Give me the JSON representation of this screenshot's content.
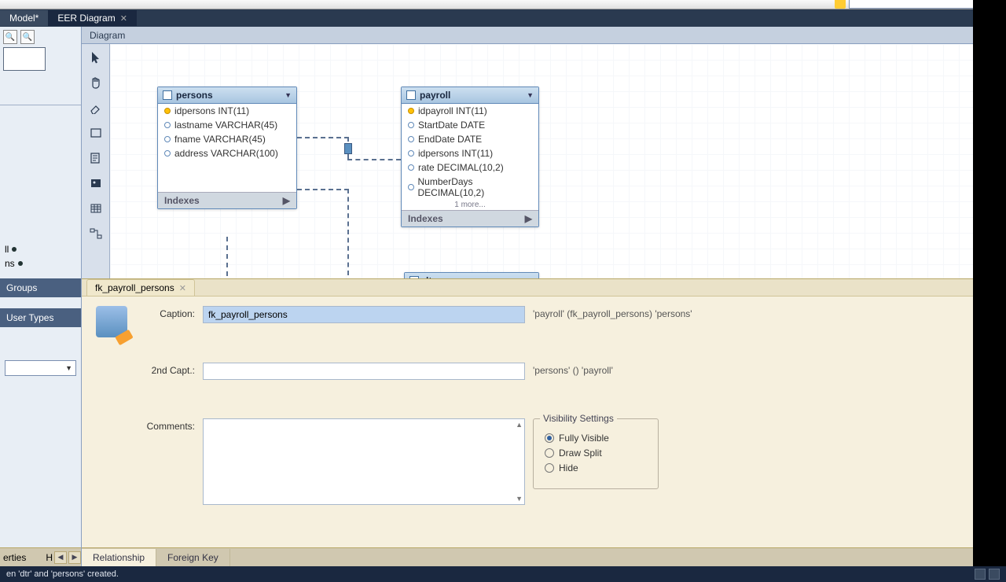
{
  "topbar": {
    "search_placeholder": ""
  },
  "tabs": {
    "model": "Model*",
    "eer": "EER Diagram"
  },
  "diagram_label": "Diagram",
  "left_tree": {
    "item1": "ll",
    "item2": "ns"
  },
  "left_sections": {
    "groups": "Groups",
    "user_types": "User Types"
  },
  "entities": {
    "persons": {
      "name": "persons",
      "cols": [
        "idpersons INT(11)",
        "lastname VARCHAR(45)",
        "fname VARCHAR(45)",
        "address VARCHAR(100)"
      ],
      "indexes": "Indexes"
    },
    "payroll": {
      "name": "payroll",
      "cols": [
        "idpayroll INT(11)",
        "StartDate DATE",
        "EndDate DATE",
        "idpersons INT(11)",
        "rate DECIMAL(10,2)",
        "NumberDays DECIMAL(10,2)"
      ],
      "more": "1 more...",
      "indexes": "Indexes"
    },
    "dtr_partial": "dtr"
  },
  "props_tab": "fk_payroll_persons",
  "props": {
    "labels": {
      "caption": "Caption:",
      "caption2": "2nd Capt.:",
      "comments": "Comments:"
    },
    "caption_value": "fk_payroll_persons",
    "caption2_value": "",
    "info1": "'payroll' (fk_payroll_persons) 'persons'",
    "info2": "'persons' () 'payroll'",
    "visibility": {
      "legend": "Visibility Settings",
      "fully": "Fully Visible",
      "draw_split": "Draw Split",
      "hide": "Hide"
    }
  },
  "bottom_tabs": {
    "relationship": "Relationship",
    "foreign_key": "Foreign Key"
  },
  "side_tabs": {
    "properties": "erties",
    "h": "H"
  },
  "status": "en 'dtr' and 'persons' created."
}
